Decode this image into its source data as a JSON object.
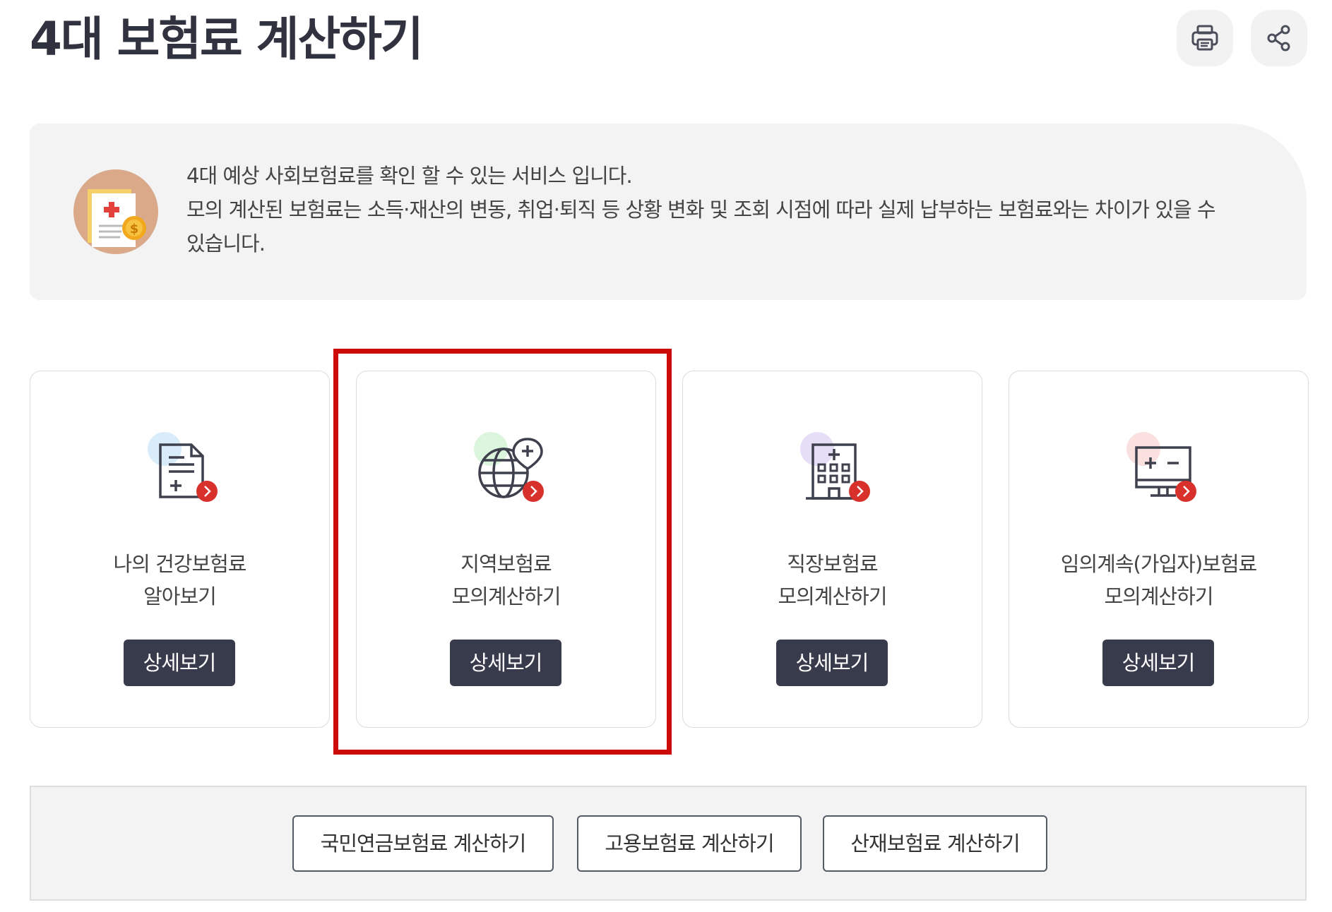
{
  "header": {
    "title": "4대 보험료 계산하기",
    "print_icon": "printer-icon",
    "share_icon": "share-icon"
  },
  "info": {
    "illustration": "medical-document-coin-icon",
    "line1": "4대 예상 사회보험료를 확인 할 수 있는 서비스 입니다.",
    "line2": "모의 계산된 보험료는 소득·재산의 변동, 취업·퇴직 등 상황 변화 및 조회 시점에 따라 실제 납부하는 보험료와는 차이가 있을 수",
    "line3": "있습니다."
  },
  "cards": [
    {
      "title_line1": "나의 건강보험료",
      "title_line2": "알아보기",
      "button": "상세보기",
      "icon": "document-plus-icon",
      "accent": "#d9ecfa"
    },
    {
      "title_line1": "지역보험료",
      "title_line2": "모의계산하기",
      "button": "상세보기",
      "icon": "globe-location-icon",
      "accent": "#dcf5dd"
    },
    {
      "title_line1": "직장보험료",
      "title_line2": "모의계산하기",
      "button": "상세보기",
      "icon": "hospital-building-icon",
      "accent": "#e6def6"
    },
    {
      "title_line1": "임의계속(가입자)보험료",
      "title_line2": "모의계산하기",
      "button": "상세보기",
      "icon": "monitor-calculator-icon",
      "accent": "#fbe0e0"
    }
  ],
  "bottom_links": {
    "pension": "국민연금보험료 계산하기",
    "employment": "고용보험료 계산하기",
    "industrial": "산재보험료 계산하기"
  },
  "colors": {
    "title": "#30323f",
    "button_bg": "#383b4c",
    "arrow_badge": "#d8302a",
    "highlight": "#cc0a0a"
  }
}
